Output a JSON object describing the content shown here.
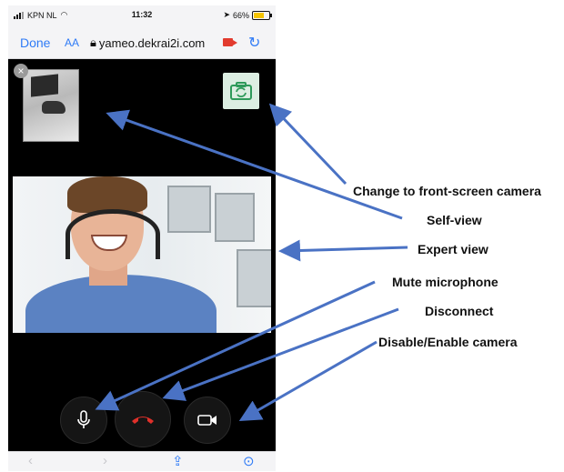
{
  "status_bar": {
    "carrier": "KPN NL",
    "time": "11:32",
    "battery": "66%",
    "battery_level": 0.66
  },
  "browser": {
    "done_label": "Done",
    "text_size_label": "AA",
    "url": "yameo.dekrai2i.com"
  },
  "call": {
    "close_glyph": "×"
  },
  "annotations": [
    {
      "name": "change-camera",
      "text": "Change to front-screen camera"
    },
    {
      "name": "self-view",
      "text": "Self-view"
    },
    {
      "name": "expert-view",
      "text": "Expert view"
    },
    {
      "name": "mute-microphone",
      "text": "Mute microphone"
    },
    {
      "name": "disconnect",
      "text": "Disconnect"
    },
    {
      "name": "disable-enable-camera",
      "text": "Disable/Enable camera"
    }
  ],
  "colors": {
    "arrow": "#4a72c4",
    "hangup": "#e0302a",
    "accent": "#2f7bf6"
  },
  "icons": {
    "switch_camera": "camera-switch-icon",
    "microphone": "microphone-icon",
    "hangup": "phone-hangup-icon",
    "camera": "video-camera-icon",
    "back": "chevron-left-icon",
    "forward": "chevron-right-icon",
    "share": "share-icon",
    "compass": "compass-icon"
  }
}
